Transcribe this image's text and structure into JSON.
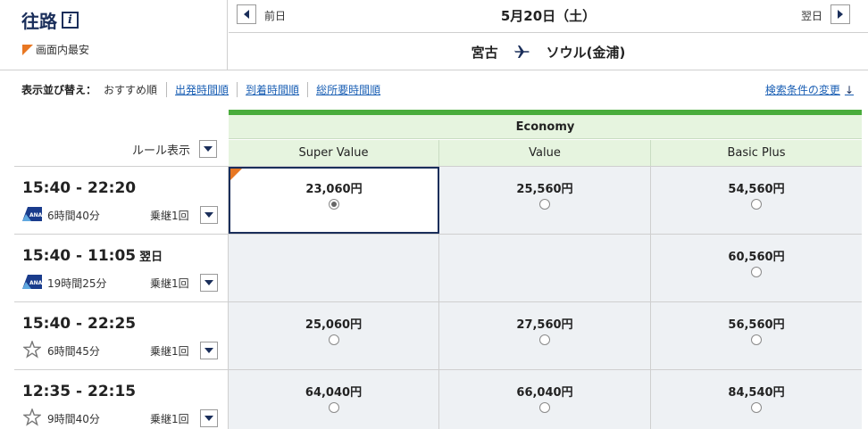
{
  "header": {
    "route_title": "往路",
    "info_icon": "i",
    "cheapest_legend": "画面内最安",
    "prev_label": "前日",
    "next_label": "翌日",
    "current_date": "5月20日（土）",
    "origin": "宮古",
    "destination": "ソウル(金浦)"
  },
  "sort": {
    "title": "表示並び替え：",
    "current": "おすすめ順",
    "options": [
      "出発時間順",
      "到着時間順",
      "総所要時間順"
    ],
    "change_search": "検索条件の変更"
  },
  "table": {
    "rule_label": "ルール表示",
    "cabin": "Economy",
    "fare_classes": [
      "Super Value",
      "Value",
      "Basic Plus"
    ]
  },
  "flights": [
    {
      "times": "15:40 - 22:20",
      "next_day": "",
      "airline_icon": "ana-logo-icon",
      "duration": "6時間40分",
      "stops": "乗継1回",
      "fares": [
        "23,060円",
        "25,560円",
        "54,560円"
      ]
    },
    {
      "times": "15:40 - 11:05",
      "next_day": "翌日",
      "airline_icon": "ana-logo-icon",
      "duration": "19時間25分",
      "stops": "乗継1回",
      "fares": [
        "",
        "",
        "60,560円"
      ]
    },
    {
      "times": "15:40 - 22:25",
      "next_day": "",
      "airline_icon": "star-alliance-icon",
      "duration": "6時間45分",
      "stops": "乗継1回",
      "fares": [
        "25,060円",
        "27,560円",
        "56,560円"
      ]
    },
    {
      "times": "12:35 - 22:15",
      "next_day": "",
      "airline_icon": "star-alliance-icon",
      "duration": "9時間40分",
      "stops": "乗継1回",
      "fares": [
        "64,040円",
        "66,040円",
        "84,540円"
      ]
    }
  ],
  "selection": {
    "flight": 0,
    "fare": 0,
    "cheapest_flag": true
  },
  "colors": {
    "accent_green": "#4aac3c",
    "navy": "#1a2e5a",
    "link": "#1a5fb4",
    "cheapest_flag": "#e87722",
    "cell_bg": "#eef1f4",
    "header_bg": "#e6f4df"
  }
}
